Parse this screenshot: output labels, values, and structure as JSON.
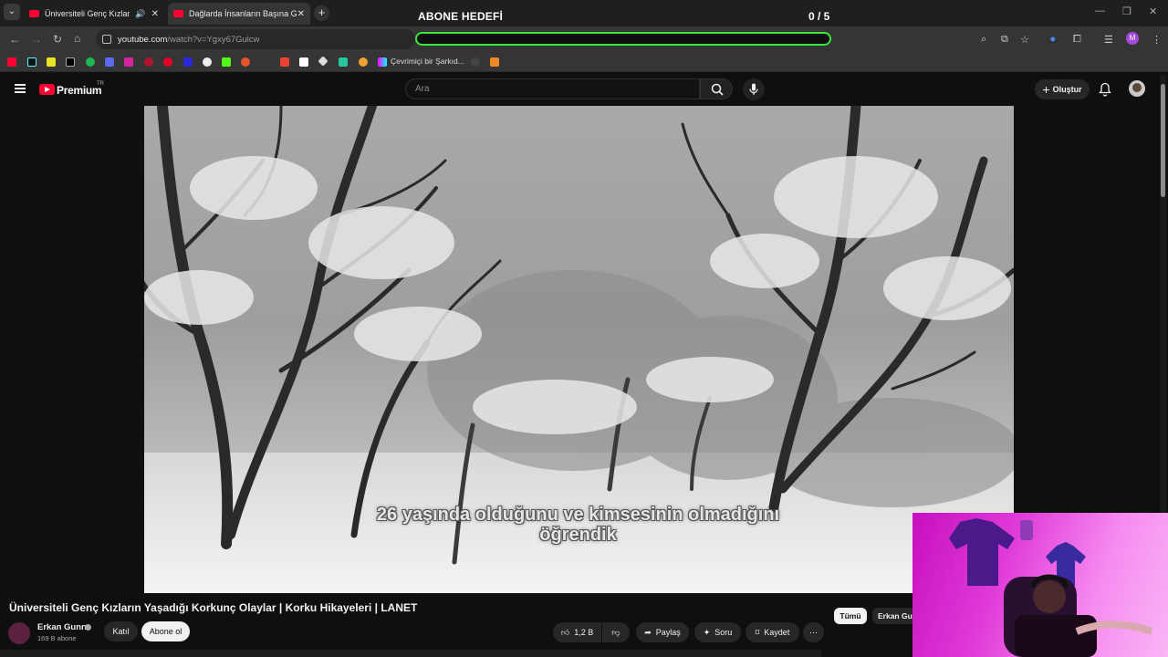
{
  "browser": {
    "tabs": [
      {
        "title": "Üniversiteli Genç Kızların Ya",
        "active": false,
        "audio": true
      },
      {
        "title": "Dağlarda İnsanların Başına Gele",
        "active": true,
        "audio": false
      }
    ],
    "url_host": "youtube.com",
    "url_path": "/watch?v=Ygxy67Gulcw",
    "bookmark_label": "Çevrimiçi bir Şarkıd...",
    "profile_initial": "M"
  },
  "overlay": {
    "goal_title": "ABONE HEDEFİ",
    "goal_count": "0 / 5",
    "goal_progress": 0,
    "goal_color": "#39e639"
  },
  "youtube": {
    "brand": "Premium",
    "region": "TR",
    "search_placeholder": "Ara",
    "create_label": "Oluştur"
  },
  "video": {
    "subtitle_line1": "26 yaşında olduğunu ve kimsesinin olmadığını",
    "subtitle_line2": "öğrendik",
    "title": "Üniversiteli Genç Kızların Yaşadığı Korkunç Olaylar | Korku Hikayeleri | LANET",
    "channel": "Erkan Gunn",
    "subscribers": "169 B abone",
    "join_label": "Katıl",
    "subscribe_label": "Abone ol",
    "likes": "1,2 B",
    "share_label": "Paylaş",
    "ask_label": "Soru",
    "save_label": "Kaydet"
  },
  "filters": {
    "all": "Tümü",
    "channel": "Erkan Gun"
  }
}
